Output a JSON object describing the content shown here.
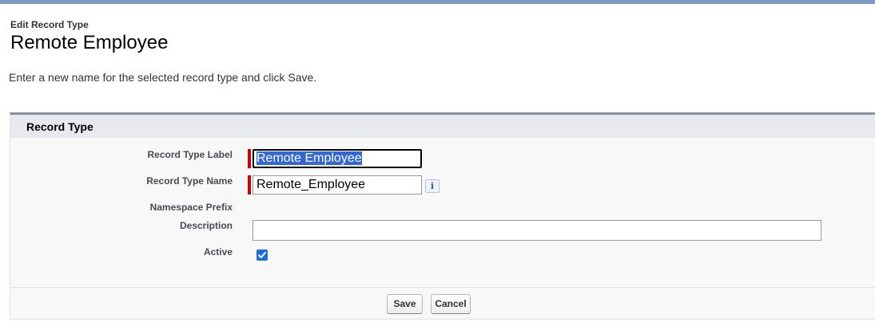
{
  "header": {
    "overline": "Edit Record Type",
    "title": "Remote Employee"
  },
  "instructions": "Enter a new name for the selected record type and click Save.",
  "section": {
    "title": "Record Type",
    "fields": {
      "label": {
        "label": "Record Type Label",
        "value": "Remote Employee",
        "required": true,
        "focused": true,
        "text_selected": true
      },
      "name": {
        "label": "Record Type Name",
        "value": "Remote_Employee",
        "required": true,
        "info_icon": "info-icon"
      },
      "namespace": {
        "label": "Namespace Prefix",
        "value": ""
      },
      "description": {
        "label": "Description",
        "value": ""
      },
      "active": {
        "label": "Active",
        "checked": true
      }
    }
  },
  "buttons": {
    "save": "Save",
    "cancel": "Cancel"
  },
  "colors": {
    "required_bar": "#cc0000",
    "selection": "#3367d6",
    "checkbox": "#1a6fe0",
    "panel_border": "#8a93a6",
    "top_band": "#7c9bc8"
  }
}
